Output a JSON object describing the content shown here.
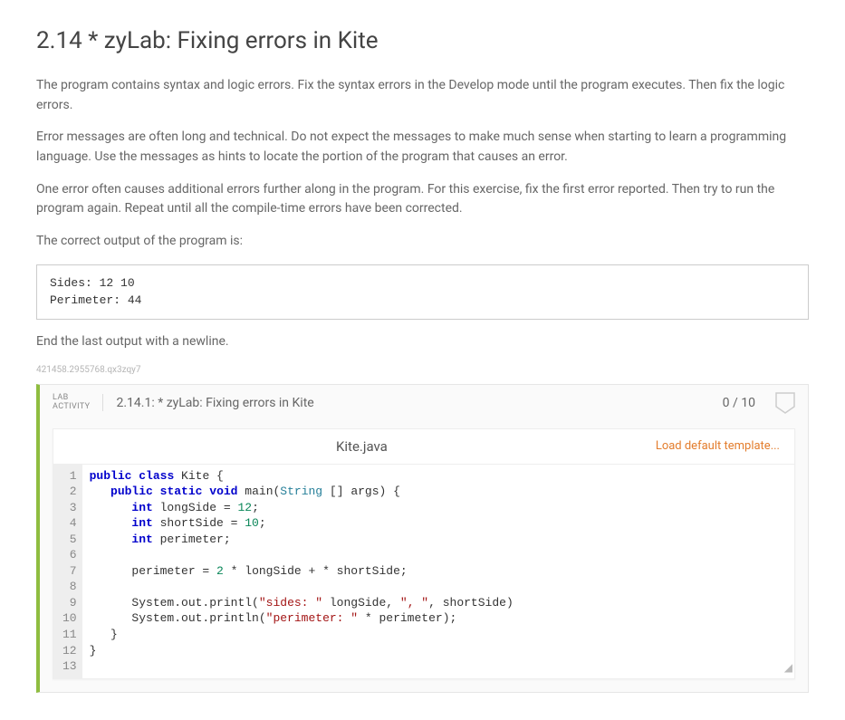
{
  "title": "2.14 * zyLab: Fixing errors in Kite",
  "paragraphs": {
    "p1": "The program contains syntax and logic errors. Fix the syntax errors in the Develop mode until the program executes. Then fix the logic errors.",
    "p2": "Error messages are often long and technical. Do not expect the messages to make much sense when starting to learn a programming language. Use the messages as hints to locate the portion of the program that causes an error.",
    "p3": "One error often causes additional errors further along in the program. For this exercise, fix the first error reported. Then try to run the program again. Repeat until all the compile-time errors have been corrected.",
    "p4": "The correct output of the program is:",
    "p5": "End the last output with a newline."
  },
  "expected_output": "Sides: 12 10\nPerimeter: 44",
  "tiny_id": "421458.2955768.qx3zqy7",
  "lab": {
    "label_line1": "LAB",
    "label_line2": "ACTIVITY",
    "title": "2.14.1: * zyLab: Fixing errors in Kite",
    "score": "0 / 10"
  },
  "editor": {
    "filename": "Kite.java",
    "load_link": "Load default template...",
    "line_count": 13,
    "code_lines": [
      {
        "n": 1,
        "tokens": [
          {
            "t": "public",
            "c": "kw"
          },
          {
            "t": " "
          },
          {
            "t": "class",
            "c": "kw"
          },
          {
            "t": " Kite {",
            "c": "cls"
          }
        ]
      },
      {
        "n": 2,
        "indent": "   ",
        "tokens": [
          {
            "t": "public",
            "c": "kw"
          },
          {
            "t": " "
          },
          {
            "t": "static",
            "c": "kw"
          },
          {
            "t": " "
          },
          {
            "t": "void",
            "c": "kw"
          },
          {
            "t": " main("
          },
          {
            "t": "String",
            "c": "type"
          },
          {
            "t": " [] args) {"
          }
        ]
      },
      {
        "n": 3,
        "indent": "      ",
        "tokens": [
          {
            "t": "int",
            "c": "kw"
          },
          {
            "t": " longSide = "
          },
          {
            "t": "12",
            "c": "num"
          },
          {
            "t": ";"
          }
        ]
      },
      {
        "n": 4,
        "indent": "      ",
        "tokens": [
          {
            "t": "int",
            "c": "kw"
          },
          {
            "t": " shortSide = "
          },
          {
            "t": "10",
            "c": "num"
          },
          {
            "t": ";"
          }
        ]
      },
      {
        "n": 5,
        "indent": "      ",
        "tokens": [
          {
            "t": "int",
            "c": "kw"
          },
          {
            "t": " perimeter;"
          }
        ]
      },
      {
        "n": 6,
        "indent": "",
        "tokens": []
      },
      {
        "n": 7,
        "indent": "      ",
        "tokens": [
          {
            "t": "perimeter = "
          },
          {
            "t": "2",
            "c": "num"
          },
          {
            "t": " * longSide + * shortSide;"
          }
        ]
      },
      {
        "n": 8,
        "indent": "",
        "tokens": []
      },
      {
        "n": 9,
        "indent": "      ",
        "tokens": [
          {
            "t": "System.out.printl("
          },
          {
            "t": "\"sides: \"",
            "c": "str"
          },
          {
            "t": " longSide, "
          },
          {
            "t": "\", \"",
            "c": "str"
          },
          {
            "t": ", shortSide)"
          }
        ]
      },
      {
        "n": 10,
        "indent": "      ",
        "tokens": [
          {
            "t": "System.out.println("
          },
          {
            "t": "\"perimeter: \"",
            "c": "str"
          },
          {
            "t": " * perimeter);"
          }
        ]
      },
      {
        "n": 11,
        "indent": "   ",
        "tokens": [
          {
            "t": "}"
          }
        ]
      },
      {
        "n": 12,
        "indent": "",
        "tokens": [
          {
            "t": "}"
          }
        ]
      },
      {
        "n": 13,
        "indent": "",
        "tokens": []
      }
    ]
  }
}
